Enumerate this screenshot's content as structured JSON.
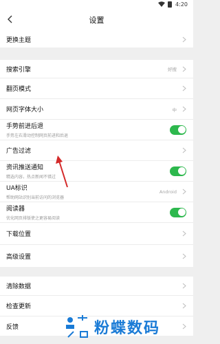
{
  "status_bar": {
    "time": "4:20"
  },
  "header": {
    "title": "设置"
  },
  "sections": {
    "theme": {
      "change_theme": "更换主题"
    },
    "browse": {
      "search_engine": {
        "label": "搜索引擎",
        "value": "好搜"
      },
      "page_turn_mode": {
        "label": "翻页模式"
      },
      "font_size": {
        "label": "网页字体大小",
        "value": "中"
      },
      "gesture": {
        "label": "手势前进后退",
        "sublabel": "手势左右滑动控制网页前进和后退"
      },
      "ad_filter": {
        "label": "广告过滤"
      },
      "news_push": {
        "label": "资讯推送通知",
        "sublabel": "精选内容，热点新闻不错过"
      },
      "ua": {
        "label": "UA标识",
        "sublabel": "帮助网站识别当前访问的浏览器",
        "value": "Android"
      },
      "reader": {
        "label": "阅读器",
        "sublabel": "优化网页排版使之更容易阅读"
      },
      "download": {
        "label": "下载位置"
      },
      "advanced": {
        "label": "高级设置"
      }
    },
    "misc": {
      "clear_data": {
        "label": "清除数据"
      },
      "check_update": {
        "label": "检查更新"
      },
      "feedback": {
        "label": "反馈"
      }
    }
  },
  "toggles": {
    "gesture": true,
    "news_push": true,
    "reader": true
  },
  "watermark": {
    "text": "粉蝶数码"
  },
  "colors": {
    "toggle_on": "#2db84d",
    "annotation_arrow": "#d42a2a",
    "watermark": "#1a7bd6"
  }
}
